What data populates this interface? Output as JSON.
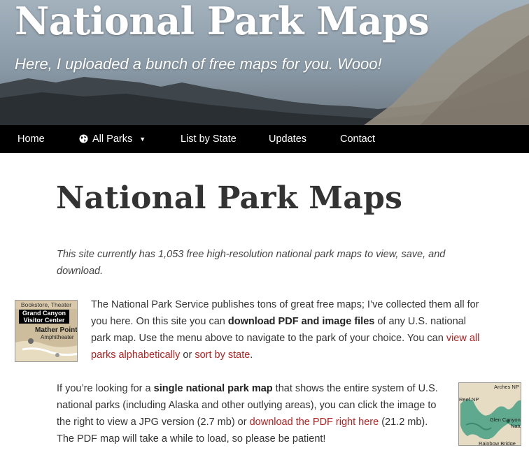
{
  "header": {
    "site_title": "National Park Maps",
    "tagline": "Here, I uploaded a bunch of free maps for you. Wooo!"
  },
  "nav": {
    "home": "Home",
    "all_parks": "All Parks",
    "list_by_state": "List by State",
    "updates": "Updates",
    "contact": "Contact"
  },
  "main": {
    "title": "National Park Maps",
    "intro": "This site currently has 1,053 free high-resolution national park maps to view, save, and download.",
    "p1": {
      "t1": "The National Park Service publishes tons of great free maps; I’ve collected them all for you here. On this site you can ",
      "b1": "download PDF and image files",
      "t2": " of any U.S. national park map. Use the menu above to navigate to the park of your choice. You can ",
      "link1": "view all parks alphabetically",
      "t3": " or ",
      "link2": "sort by state",
      "t4": "."
    },
    "p2": {
      "t1": "If you’re looking for a ",
      "b1": "single national park map",
      "t2": " that shows the entire system of U.S. national parks (including Alaska and other outlying areas), you can click the image to the right to view a JPG version (2.7 mb) or ",
      "link1": "download the PDF right here",
      "t3": " (21.2 mb). The PDF map will take a while to load, so please be patient!"
    }
  },
  "thumb1": {
    "top": "Bookstore, Theater",
    "box": "Grand Canyon Visitor Center",
    "point": "Mather Point",
    "amph": "Amphitheater"
  },
  "thumb2": {
    "arches": "Arches NP",
    "reef": "Reef NP",
    "glen": "Glen Canyon",
    "natu": "Natu",
    "rainbow": "Rainbow Bridge"
  },
  "colors": {
    "nav_bg": "#000000",
    "link": "#b22222",
    "text": "#333333"
  }
}
